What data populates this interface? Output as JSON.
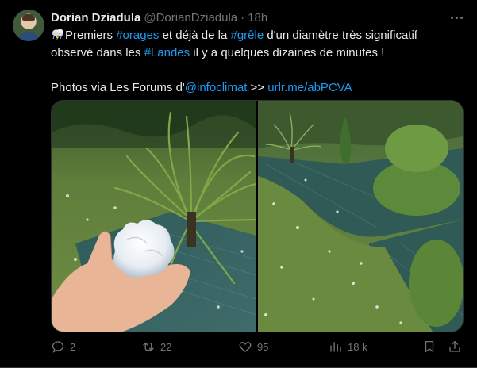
{
  "author": {
    "name": "Dorian Dziadula",
    "handle": "@DorianDziadula",
    "separator": "·",
    "time": "18h"
  },
  "tweet": {
    "line1": [
      {
        "t": "Premiers ",
        "link": false
      },
      {
        "t": "#orages",
        "link": true
      },
      {
        "t": " et déjà de la ",
        "link": false
      },
      {
        "t": "#grêle",
        "link": true
      },
      {
        "t": " d'un diamètre très significatif",
        "link": false
      }
    ],
    "line2": [
      {
        "t": "observé dans les ",
        "link": false
      },
      {
        "t": "#Landes",
        "link": true
      },
      {
        "t": " il y a quelques dizaines de minutes !",
        "link": false
      }
    ],
    "line3": [
      {
        "t": "Photos via Les Forums d'",
        "link": false
      },
      {
        "t": "@infoclimat",
        "link": true
      },
      {
        "t": " >> ",
        "link": false
      },
      {
        "t": "urlr.me/abPCVA",
        "link": true
      }
    ],
    "emoji_icon": "thunder-cloud-rain-icon"
  },
  "media": [
    {
      "icon": "photo-hand-holding-hailstone"
    },
    {
      "icon": "photo-hail-covered-garden"
    }
  ],
  "stats": {
    "replies": "2",
    "reposts": "22",
    "likes": "95",
    "views": "18 k"
  },
  "colors": {
    "link": "#1d9bf0",
    "text": "#e7e9ea",
    "muted": "#71767b",
    "background": "#000000"
  }
}
